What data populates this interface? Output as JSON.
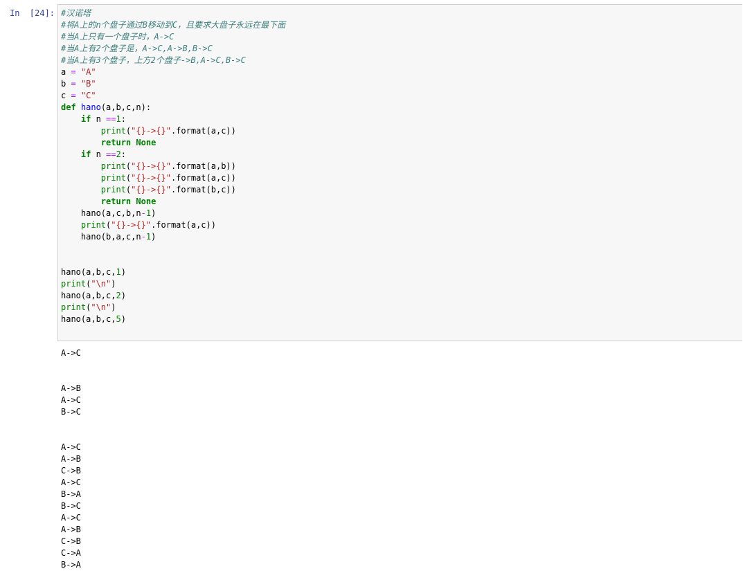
{
  "cell": {
    "prompt": "In  [24]:",
    "code_lines": [
      [
        {
          "t": "#汉诺塔",
          "c": "comment"
        }
      ],
      [
        {
          "t": "#将A上的n个盘子通过B移动到C，且要求大盘子永远在最下面",
          "c": "comment"
        }
      ],
      [
        {
          "t": "#当A上只有一个盘子时，A->C",
          "c": "comment"
        }
      ],
      [
        {
          "t": "#当A上有2个盘子是，A->C,A->B,B->C",
          "c": "comment"
        }
      ],
      [
        {
          "t": "#当A上有3个盘子，上方2个盘子->B,A->C,B->C",
          "c": "comment"
        }
      ],
      [
        {
          "t": "a ",
          "c": "plain"
        },
        {
          "t": "=",
          "c": "op"
        },
        {
          "t": " ",
          "c": "plain"
        },
        {
          "t": "\"A\"",
          "c": "str"
        }
      ],
      [
        {
          "t": "b ",
          "c": "plain"
        },
        {
          "t": "=",
          "c": "op"
        },
        {
          "t": " ",
          "c": "plain"
        },
        {
          "t": "\"B\"",
          "c": "str"
        }
      ],
      [
        {
          "t": "c ",
          "c": "plain"
        },
        {
          "t": "=",
          "c": "op"
        },
        {
          "t": " ",
          "c": "plain"
        },
        {
          "t": "\"C\"",
          "c": "str"
        }
      ],
      [
        {
          "t": "def",
          "c": "kw"
        },
        {
          "t": " ",
          "c": "plain"
        },
        {
          "t": "hano",
          "c": "fn"
        },
        {
          "t": "(a,b,c,n):",
          "c": "plain"
        }
      ],
      [
        {
          "t": "    ",
          "c": "plain"
        },
        {
          "t": "if",
          "c": "kw"
        },
        {
          "t": " n ",
          "c": "plain"
        },
        {
          "t": "==",
          "c": "op"
        },
        {
          "t": "1",
          "c": "num"
        },
        {
          "t": ":",
          "c": "plain"
        }
      ],
      [
        {
          "t": "        ",
          "c": "plain"
        },
        {
          "t": "print",
          "c": "builtin"
        },
        {
          "t": "(",
          "c": "plain"
        },
        {
          "t": "\"{}->{}\"",
          "c": "str"
        },
        {
          "t": ".format(a,c))",
          "c": "plain"
        }
      ],
      [
        {
          "t": "        ",
          "c": "plain"
        },
        {
          "t": "return",
          "c": "kw"
        },
        {
          "t": " ",
          "c": "plain"
        },
        {
          "t": "None",
          "c": "kw"
        }
      ],
      [
        {
          "t": "    ",
          "c": "plain"
        },
        {
          "t": "if",
          "c": "kw"
        },
        {
          "t": " n ",
          "c": "plain"
        },
        {
          "t": "==",
          "c": "op"
        },
        {
          "t": "2",
          "c": "num"
        },
        {
          "t": ":",
          "c": "plain"
        }
      ],
      [
        {
          "t": "        ",
          "c": "plain"
        },
        {
          "t": "print",
          "c": "builtin"
        },
        {
          "t": "(",
          "c": "plain"
        },
        {
          "t": "\"{}->{}\"",
          "c": "str"
        },
        {
          "t": ".format(a,b))",
          "c": "plain"
        }
      ],
      [
        {
          "t": "        ",
          "c": "plain"
        },
        {
          "t": "print",
          "c": "builtin"
        },
        {
          "t": "(",
          "c": "plain"
        },
        {
          "t": "\"{}->{}\"",
          "c": "str"
        },
        {
          "t": ".format(a,c))",
          "c": "plain"
        }
      ],
      [
        {
          "t": "        ",
          "c": "plain"
        },
        {
          "t": "print",
          "c": "builtin"
        },
        {
          "t": "(",
          "c": "plain"
        },
        {
          "t": "\"{}->{}\"",
          "c": "str"
        },
        {
          "t": ".format(b,c))",
          "c": "plain"
        }
      ],
      [
        {
          "t": "        ",
          "c": "plain"
        },
        {
          "t": "return",
          "c": "kw"
        },
        {
          "t": " ",
          "c": "plain"
        },
        {
          "t": "None",
          "c": "kw"
        }
      ],
      [
        {
          "t": "    hano(a,c,b,n",
          "c": "plain"
        },
        {
          "t": "-",
          "c": "op"
        },
        {
          "t": "1",
          "c": "num"
        },
        {
          "t": ")",
          "c": "plain"
        }
      ],
      [
        {
          "t": "    ",
          "c": "plain"
        },
        {
          "t": "print",
          "c": "builtin"
        },
        {
          "t": "(",
          "c": "plain"
        },
        {
          "t": "\"{}->{}\"",
          "c": "str"
        },
        {
          "t": ".format(a,c))",
          "c": "plain"
        }
      ],
      [
        {
          "t": "    hano(b,a,c,n",
          "c": "plain"
        },
        {
          "t": "-",
          "c": "op"
        },
        {
          "t": "1",
          "c": "num"
        },
        {
          "t": ")",
          "c": "plain"
        }
      ],
      [],
      [],
      [
        {
          "t": "hano(a,b,c,",
          "c": "plain"
        },
        {
          "t": "1",
          "c": "num"
        },
        {
          "t": ")",
          "c": "plain"
        }
      ],
      [
        {
          "t": "print",
          "c": "builtin"
        },
        {
          "t": "(",
          "c": "plain"
        },
        {
          "t": "\"\\n\"",
          "c": "str"
        },
        {
          "t": ")",
          "c": "plain"
        }
      ],
      [
        {
          "t": "hano(a,b,c,",
          "c": "plain"
        },
        {
          "t": "2",
          "c": "num"
        },
        {
          "t": ")",
          "c": "plain"
        }
      ],
      [
        {
          "t": "print",
          "c": "builtin"
        },
        {
          "t": "(",
          "c": "plain"
        },
        {
          "t": "\"\\n\"",
          "c": "str"
        },
        {
          "t": ")",
          "c": "plain"
        }
      ],
      [
        {
          "t": "hano(a,b,c,",
          "c": "plain"
        },
        {
          "t": "5",
          "c": "num"
        },
        {
          "t": ")",
          "c": "plain"
        }
      ]
    ],
    "output_lines": [
      "A->C",
      "",
      "",
      "A->B",
      "A->C",
      "B->C",
      "",
      "",
      "A->C",
      "A->B",
      "C->B",
      "A->C",
      "B->A",
      "B->C",
      "A->C",
      "A->B",
      "C->B",
      "C->A",
      "B->A"
    ]
  },
  "colors": {
    "prompt": "#303f9f",
    "input_background": "#f7f7f7",
    "input_border": "#cfcfcf",
    "comment": "#408080",
    "keyword": "#008000",
    "string": "#ba2121",
    "operator": "#aa22ff"
  }
}
